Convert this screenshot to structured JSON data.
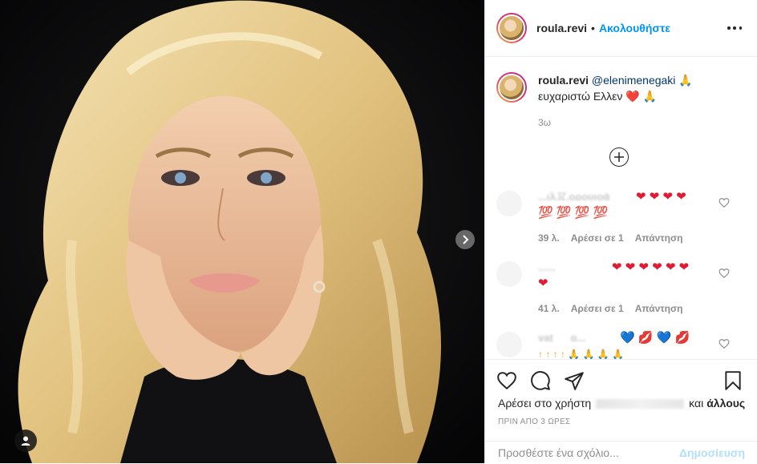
{
  "post": {
    "author": "roula.revi",
    "separator": "•",
    "follow_label": "Ακολουθήστε"
  },
  "caption": {
    "username": "roula.revi",
    "mention": "@elenimenegaki",
    "emoji_1": "🙏",
    "text": "ευχαριστώ Ελλεν",
    "emoji_2": "❤️",
    "emoji_3": "🙏",
    "time": "3ω"
  },
  "comments": [
    {
      "username": "...ιλ.ΐζ.ορουιοά",
      "line1": "❤ ❤ ❤ ❤",
      "line2": "💯 💯 💯 💯",
      "time": "39 λ.",
      "likes": "Αρέσει σε 1",
      "reply": "Απάντηση"
    },
    {
      "username": "......",
      "line1": "❤ ❤ ❤ ❤ ❤ ❤",
      "line2": "❤",
      "time": "41 λ.",
      "likes": "Αρέσει σε 1",
      "reply": "Απάντηση"
    },
    {
      "username": "vat___g...",
      "line1": "💙 💋 💙 💋",
      "line2": "↑ ↑ ↑ ↑ 🙏 🙏 🙏 🙏"
    }
  ],
  "likes": {
    "prefix": "Αρέσει στο χρήστη",
    "suffix": "και",
    "others": "άλλους"
  },
  "posted_time": "ΠΡΙΝ ΑΠΟ 3 ΩΡΕΣ",
  "add_comment": {
    "placeholder": "Προσθέστε ένα σχόλιο...",
    "post_label": "Δημοσίευση"
  },
  "colors": {
    "accent": "#0095f6",
    "post_disabled": "#b2dffc",
    "muted": "#8e8e8e",
    "like_red": "#e01b33"
  }
}
